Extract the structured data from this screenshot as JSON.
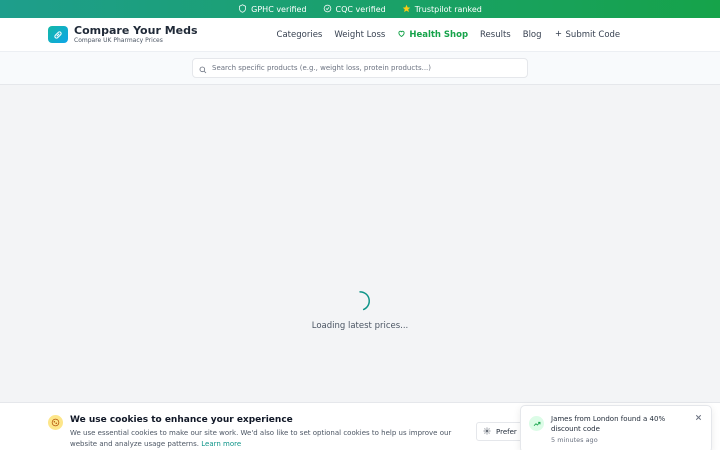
{
  "topbar": {
    "items": [
      {
        "label": "GPHC verified",
        "icon": "shield-icon"
      },
      {
        "label": "CQC verified",
        "icon": "check-circle-icon"
      },
      {
        "label": "Trustpilot ranked",
        "icon": "star-icon"
      }
    ]
  },
  "header": {
    "logo_title": "Compare Your Meds",
    "logo_subtitle": "Compare UK Pharmacy Prices",
    "nav": {
      "categories": "Categories",
      "weight_loss": "Weight Loss",
      "health_shop": "Health Shop",
      "results": "Results",
      "blog": "Blog",
      "submit_code": "Submit Code"
    }
  },
  "search": {
    "placeholder": "Search specific products (e.g., weight loss, protein products...)"
  },
  "main": {
    "loading_text": "Loading latest prices..."
  },
  "cookie": {
    "title": "We use cookies to enhance your experience",
    "text": "We use essential cookies to make our site work. We'd also like to set optional cookies to help us improve our website and analyze usage patterns.",
    "link": "Learn more",
    "preferences_label": "Prefer"
  },
  "toast": {
    "message": "James from London found a 40% discount code",
    "time": "5 minutes ago"
  },
  "colors": {
    "brand_teal": "#14b8a6",
    "brand_green": "#16a34a",
    "topbar_gradient_start": "#1e9e8c"
  }
}
